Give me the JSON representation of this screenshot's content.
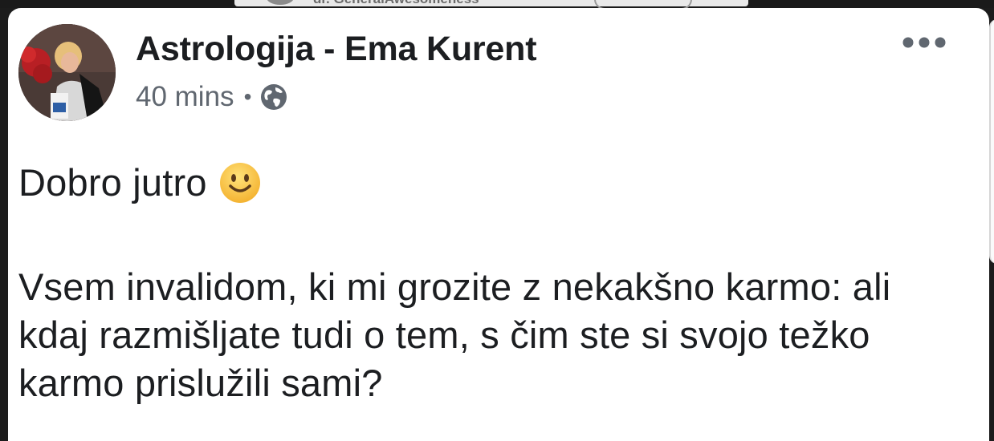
{
  "background_partial": {
    "text": "dr. GeneralAwesomeness"
  },
  "post": {
    "author": "Astrologija - Ema Kurent",
    "timestamp": "40 mins",
    "separator": "•",
    "privacy_icon": "globe-icon",
    "more_icon": "ellipsis-icon",
    "greeting": "Dobro jutro",
    "greeting_emoji": "smiley-icon",
    "message": "Vsem invalidom, ki mi grozite z nekakšno karmo: ali kdaj razmišljate tudi o tem, s čim ste si svojo težko karmo prislužili sami?"
  },
  "colors": {
    "card_background": "#ffffff",
    "page_background": "#1c1c1c",
    "name_text": "#1c1e21",
    "meta_text": "#606770",
    "emoji_fill": "#f7c43a"
  }
}
